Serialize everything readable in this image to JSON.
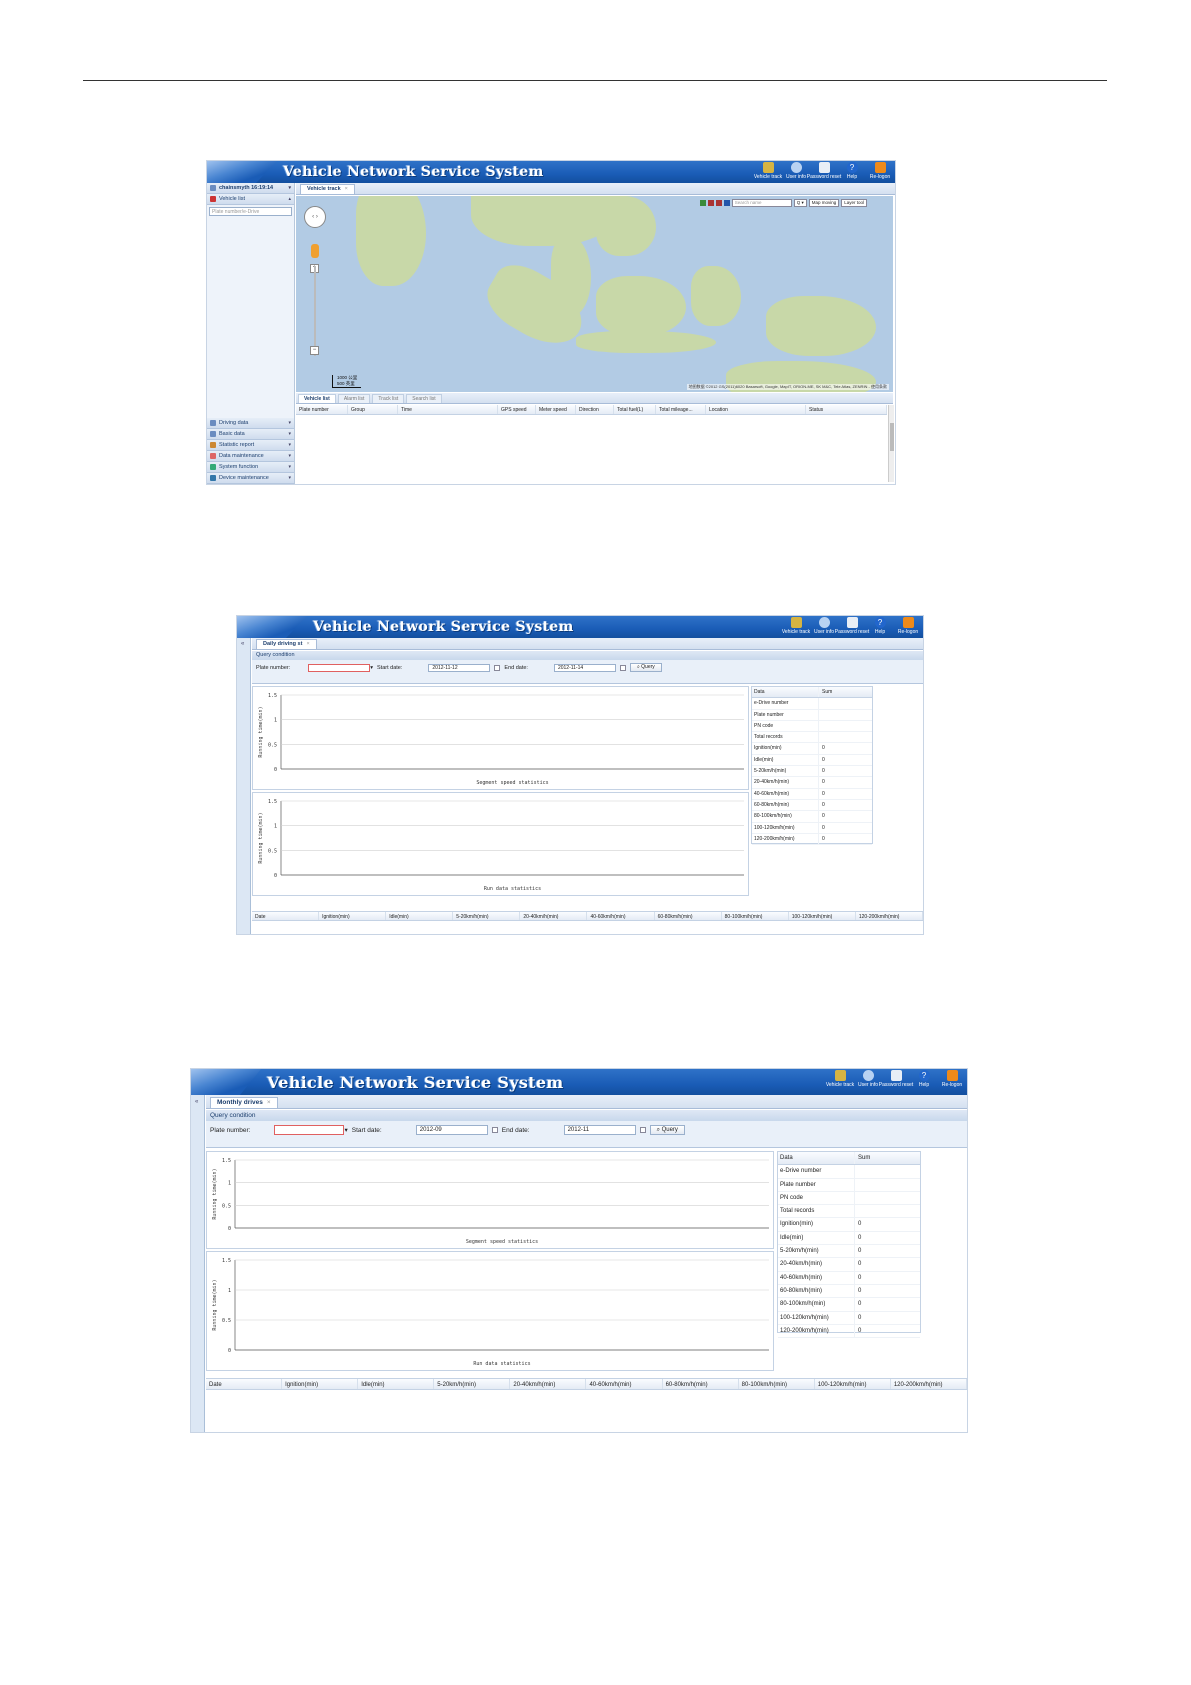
{
  "app_title": "Vehicle Network Service System",
  "toolbar": {
    "vehicle_track": "Vehicle track",
    "user_info": "User info",
    "password_reset": "Password reset",
    "help": "Help",
    "relogon": "Re-logon"
  },
  "shot1": {
    "user": "chainsmyth 16:19:14",
    "vehicle_list": "Vehicle list",
    "search_placeholder": "Plate number/e-Drive",
    "tab": "Vehicle track",
    "map": {
      "search_placeholder": "Search name",
      "map_select": "Map moving",
      "layer_select": "Layer tool",
      "scale_top": "1000 公里",
      "scale_bottom": "500 英里",
      "copyright": "地图数据 ©2012 GS(2011)6020 Basarsoft, Google, MapIT, ORION-ME, SK M&C, Tele Atlas, ZENRIN - 使用条款"
    },
    "menu": [
      "Driving data",
      "Basic data",
      "Statistic report",
      "Data maintenance",
      "System function",
      "Device maintenance"
    ],
    "list_tabs": [
      "Vehicle list",
      "Alarm list",
      "Track list",
      "Search list"
    ],
    "columns": [
      "Plate number",
      "Group",
      "Time",
      "GPS speed",
      "Meter speed",
      "Direction",
      "Total fuel(L)",
      "Total mileage...",
      "Location",
      "Status"
    ]
  },
  "shot2": {
    "tab": "Daily driving st",
    "query_title": "Query condition",
    "plate_label": "Plate number:",
    "start_label": "Start date:",
    "start_value": "2012-11-12",
    "end_label": "End date:",
    "end_value": "2012-11-14",
    "query_button": "Query"
  },
  "shot3": {
    "tab": "Monthly drives",
    "query_title": "Query condition",
    "plate_label": "Plate number:",
    "start_label": "Start date:",
    "start_value": "2012-09",
    "end_label": "End date:",
    "end_value": "2012-11",
    "query_button": "Query"
  },
  "stat_table": {
    "headers": [
      "Data",
      "Sum"
    ],
    "rows": [
      [
        "e-Drive number",
        ""
      ],
      [
        "Plate number",
        ""
      ],
      [
        "PN code",
        ""
      ],
      [
        "Total records",
        ""
      ],
      [
        "Ignition(min)",
        "0"
      ],
      [
        "Idle(min)",
        "0"
      ],
      [
        "5-20km/h(min)",
        "0"
      ],
      [
        "20-40km/h(min)",
        "0"
      ],
      [
        "40-60km/h(min)",
        "0"
      ],
      [
        "60-80km/h(min)",
        "0"
      ],
      [
        "80-100km/h(min)",
        "0"
      ],
      [
        "100-120km/h(min)",
        "0"
      ],
      [
        "120-200km/h(min)",
        "0"
      ]
    ]
  },
  "bottom_columns": [
    "Date",
    "Ignition(min)",
    "Idle(min)",
    "5-20km/h(min)",
    "20-40km/h(min)",
    "40-60km/h(min)",
    "60-80km/h(min)",
    "80-100km/h(min)",
    "100-120km/h(min)",
    "120-200km/h(min)"
  ],
  "chart_data": [
    {
      "type": "line",
      "title": "Segment speed statistics",
      "ylabel": "Running time(min)",
      "ylim": [
        0,
        1.5
      ],
      "yticks": [
        "0",
        "0.5",
        "1",
        "1.5"
      ],
      "series": []
    },
    {
      "type": "line",
      "title": "Run data statistics",
      "ylabel": "Running time(min)",
      "ylim": [
        0,
        1.5
      ],
      "yticks": [
        "0",
        "0.5",
        "1",
        "1.5"
      ],
      "series": []
    }
  ]
}
